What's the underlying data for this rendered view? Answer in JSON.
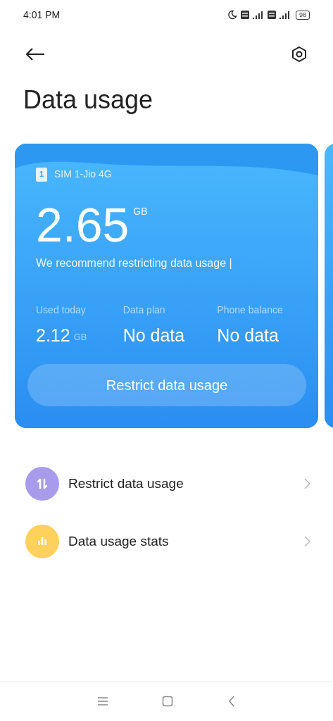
{
  "status_bar": {
    "time": "4:01 PM",
    "battery": "98"
  },
  "title": "Data usage",
  "card": {
    "sim_number": "1",
    "sim_label": "SIM 1-Jio 4G",
    "usage": "2.65",
    "usage_unit": "GB",
    "message": "We recommend restricting data usage |",
    "stats": [
      {
        "label": "Used today",
        "value": "2.12",
        "unit": "GB"
      },
      {
        "label": "Data plan",
        "value": "No data"
      },
      {
        "label": "Phone balance",
        "value": "No data"
      }
    ],
    "button": "Restrict data usage"
  },
  "menu": [
    {
      "kind": "transfer",
      "label": "Restrict data usage",
      "color": "#a99bec"
    },
    {
      "kind": "stats",
      "label": "Data usage stats",
      "color": "#fdd15b"
    }
  ]
}
